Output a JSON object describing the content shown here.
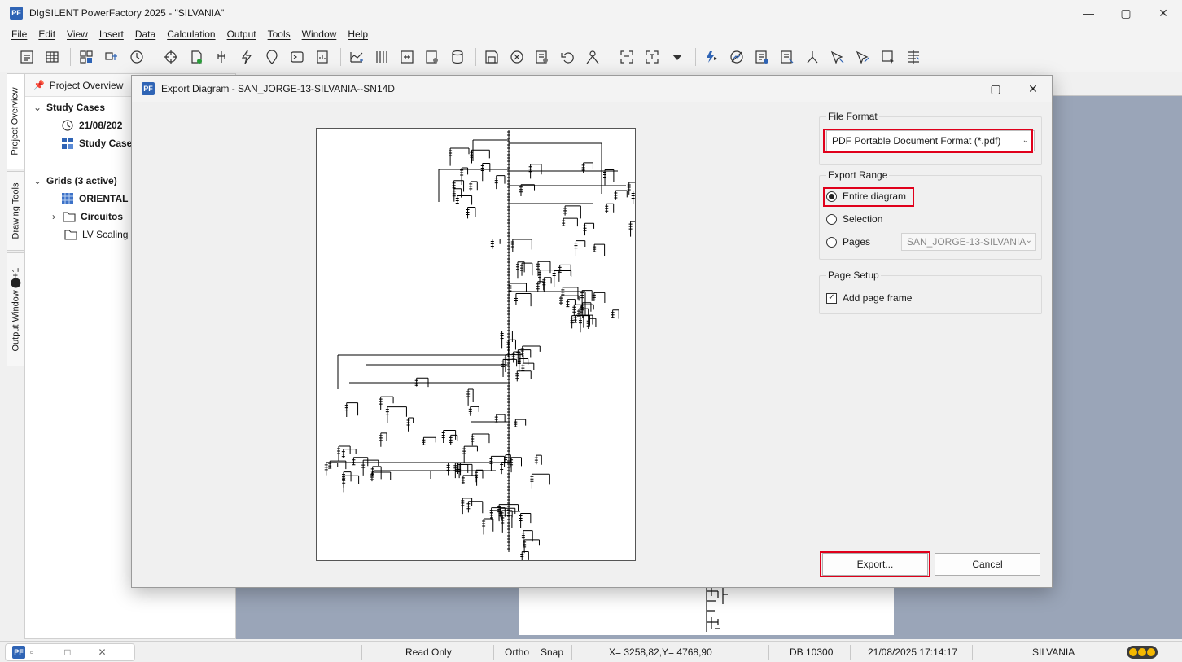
{
  "app": {
    "logo": "PF",
    "title": "DIgSILENT PowerFactory 2025  - \"SILVANIA\"",
    "window_controls": [
      "—",
      "▢",
      "✕"
    ]
  },
  "menu": [
    "File",
    "Edit",
    "View",
    "Insert",
    "Data",
    "Calculation",
    "Output",
    "Tools",
    "Window",
    "Help"
  ],
  "toolbar_icons": [
    "text-icon",
    "table-icon",
    "grid-icon",
    "network-icon",
    "clock-icon",
    "target-icon",
    "page-check-icon",
    "switch-icon",
    "lightning-icon",
    "marker-icon",
    "terminal-icon",
    "report-icon",
    "plot-icon",
    "bars-icon",
    "frame-icon",
    "settings-page-icon",
    "database-icon",
    "save-icon",
    "cancel-icon",
    "calc-icon",
    "undo-icon",
    "person-icon",
    "zoom-fit-icon",
    "zoom-text-icon",
    "dropdown-icon",
    "run-icon",
    "graph-off-icon",
    "report2-icon",
    "report3-icon",
    "fork-icon",
    "arrow-select-icon",
    "arrow-select2-icon",
    "cursor-select-icon",
    "chart-lines-icon"
  ],
  "left_tabs": [
    "Project Overview",
    "Drawing Tools",
    "Output Window",
    "+1"
  ],
  "project": {
    "header": "Project Overview",
    "study_cases": "Study Cases",
    "study_case_date": "21/08/202",
    "study_case_item": "Study Case",
    "grids": "Grids (3 active)",
    "oriental": "ORIENTAL",
    "circuitos": "Circuitos",
    "lv_scaling": "LV Scaling"
  },
  "dialog": {
    "logo": "PF",
    "title": "Export Diagram - SAN_JORGE-13-SILVANIA--SN14D",
    "controls": [
      "—",
      "▢",
      "✕"
    ],
    "file_format": {
      "label": "File Format",
      "selected": "PDF Portable Document Format (*.pdf)"
    },
    "export_range": {
      "label": "Export Range",
      "options": [
        "Entire diagram",
        "Selection",
        "Pages"
      ],
      "selected_index": 0,
      "pages_value": "SAN_JORGE-13-SILVANIA"
    },
    "page_setup": {
      "label": "Page Setup",
      "add_page_frame": "Add page frame",
      "add_page_frame_checked": true
    },
    "export_button": "Export...",
    "cancel_button": "Cancel"
  },
  "status": {
    "read_only": "Read Only",
    "ortho": "Ortho",
    "snap": "Snap",
    "coords": "X=  3258,82,Y=  4768,90",
    "db": "DB 10300",
    "datetime": "21/08/2025 17:14:17",
    "project": "SILVANIA"
  },
  "colors": {
    "highlight": "#e0001b",
    "brand": "#2f64b5",
    "diagram_bg": "#9aa5b8"
  }
}
